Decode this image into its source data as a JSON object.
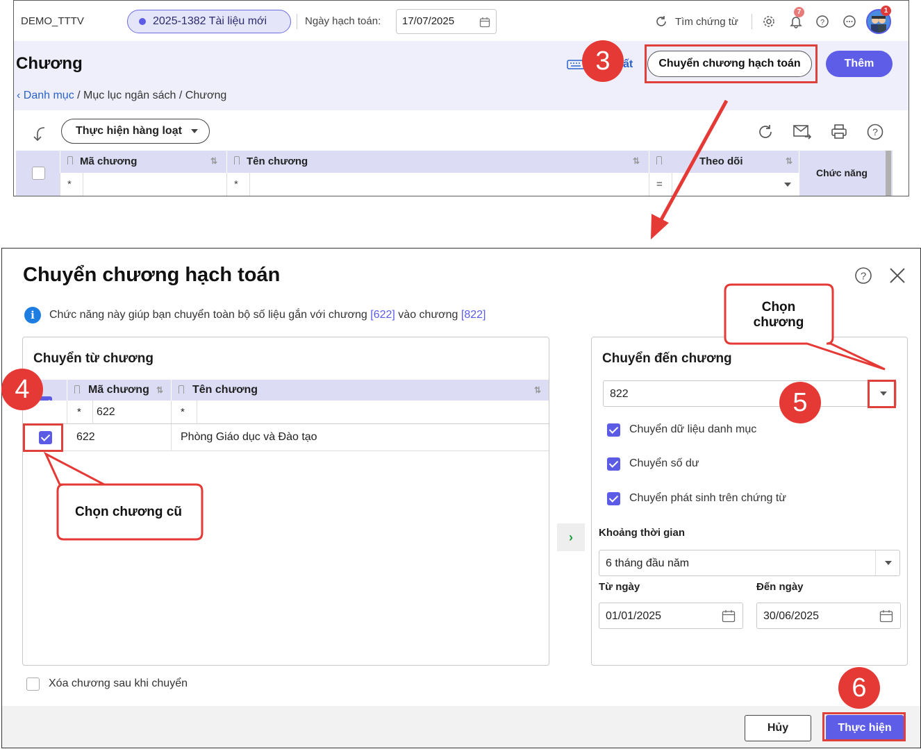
{
  "top": {
    "company": "DEMO_TTTV",
    "doc_pill": "2025-1382 Tài liệu mới",
    "date_label": "Ngày hạch toán:",
    "date_value": "17/07/2025",
    "search_doc": "Tìm chứng từ",
    "notif_count": "7",
    "avatar_badge": "1",
    "page_title": "Chương",
    "breadcrumb_root": "Danh mục",
    "breadcrumb_rest": " / Mục lục ngân sách / Chương",
    "export_label": "ất",
    "btn_transfer": "Chuyển chương hạch toán",
    "btn_add": "Thêm",
    "btn_batch": "Thực hiện hàng loạt",
    "grid": {
      "col_code": "Mã chương",
      "col_name": "Tên chương",
      "col_follow": "Theo dõi",
      "col_func": "Chức năng",
      "filter_star": "*",
      "filter_eq": "="
    }
  },
  "dialog": {
    "title": "Chuyển chương hạch toán",
    "info_prefix": "Chức năng này giúp bạn chuyển toàn bộ số liệu gắn với chương ",
    "info_from": "[622]",
    "info_mid": " vào chương ",
    "info_to": "[822]",
    "left_title": "Chuyển từ chương",
    "col_code": "Mã chương",
    "col_name": "Tên chương",
    "filter_star": "*",
    "filter_code": "622",
    "row_code": "622",
    "row_name": "Phòng Giáo dục và Đào tạo",
    "mid_arrow": "›",
    "right_title": "Chuyển đến chương",
    "target_value": "822",
    "opt1": "Chuyển dữ liệu danh mục",
    "opt2": "Chuyển số dư",
    "opt3": "Chuyển phát sinh trên chứng từ",
    "period_label": "Khoảng thời gian",
    "period_value": "6 tháng đầu năm",
    "from_label": "Từ ngày",
    "to_label": "Đến ngày",
    "from_value": "01/01/2025",
    "to_value": "30/06/2025",
    "delete_opt": "Xóa chương sau khi chuyển",
    "btn_cancel": "Hủy",
    "btn_exec": "Thực hiện"
  },
  "annotations": {
    "step3": "3",
    "step4": "4",
    "step5": "5",
    "step6": "6",
    "callout_select_line1": "Chọn",
    "callout_select_line2": "chương",
    "callout_old": "Chọn chương cũ"
  },
  "colors": {
    "accent": "#5d5de8",
    "annotation_red": "#e53935",
    "header_bg": "#efeffb",
    "grid_head_bg": "#dcdcf5"
  }
}
